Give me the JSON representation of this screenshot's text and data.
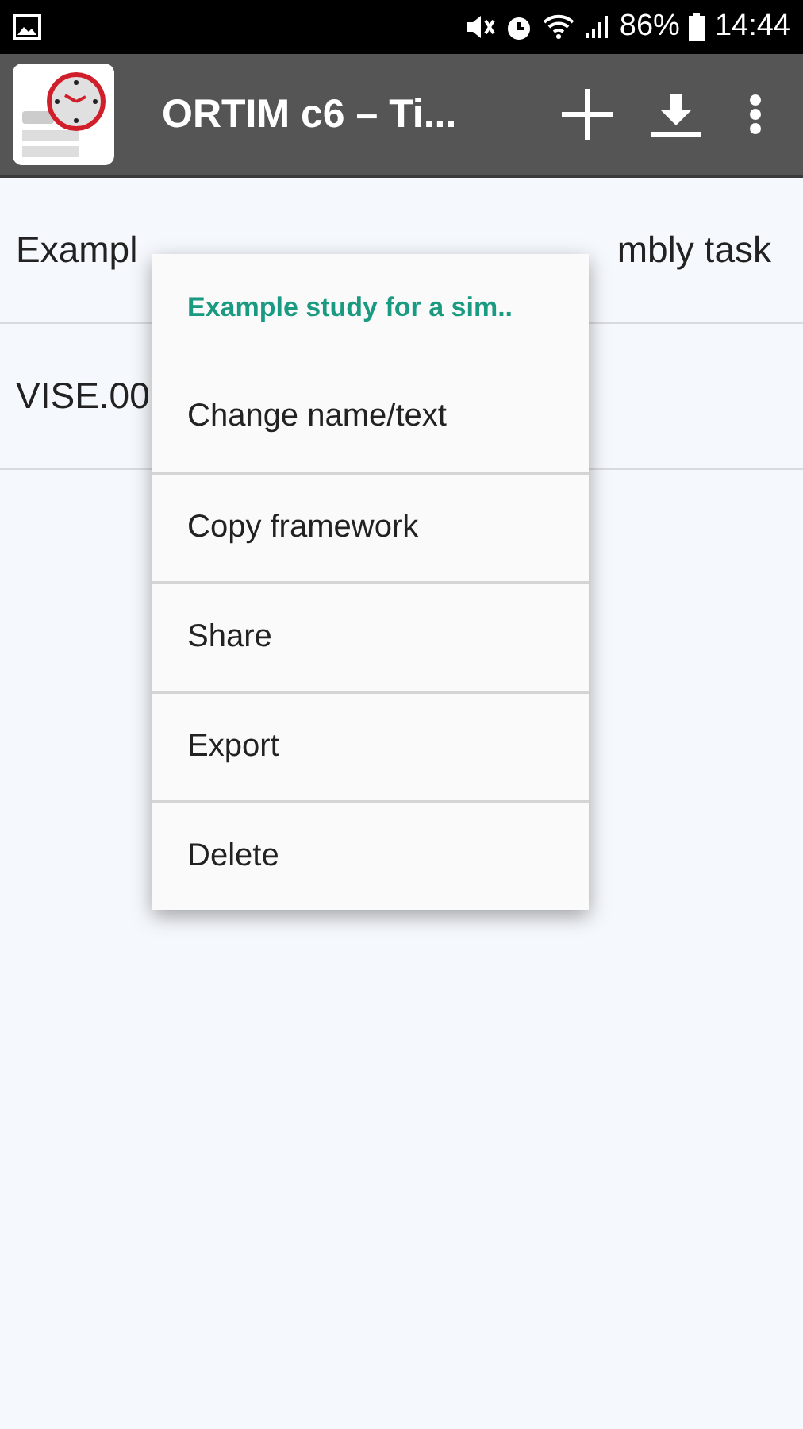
{
  "status_bar": {
    "battery": "86%",
    "time": "14:44"
  },
  "app_bar": {
    "title": "ORTIM c6 – Ti..."
  },
  "list": [
    {
      "text": "Exampl",
      "text_right": "mbly task"
    },
    {
      "text": "VISE.00"
    }
  ],
  "context_menu": {
    "title": "Example study for a sim..",
    "items": [
      {
        "label": "Change name/text"
      },
      {
        "label": "Copy framework"
      },
      {
        "label": "Share"
      },
      {
        "label": "Export"
      },
      {
        "label": "Delete"
      }
    ]
  }
}
